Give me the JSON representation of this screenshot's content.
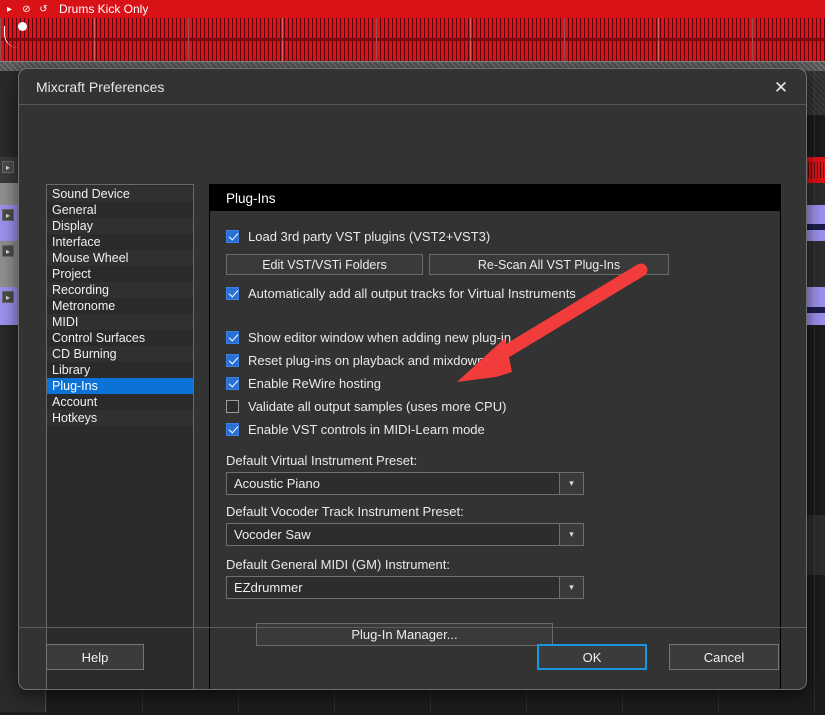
{
  "background": {
    "clip_label": "Drums Kick Only",
    "clip_controls": [
      "▸",
      "⊘",
      "↺"
    ]
  },
  "dialog": {
    "title": "Mixcraft Preferences",
    "close_icon": "✕"
  },
  "sidebar": {
    "items": [
      {
        "label": "Sound Device",
        "selected": false
      },
      {
        "label": "General",
        "selected": false
      },
      {
        "label": "Display",
        "selected": false
      },
      {
        "label": "Interface",
        "selected": false
      },
      {
        "label": "Mouse Wheel",
        "selected": false
      },
      {
        "label": "Project",
        "selected": false
      },
      {
        "label": "Recording",
        "selected": false
      },
      {
        "label": "Metronome",
        "selected": false
      },
      {
        "label": "MIDI",
        "selected": false
      },
      {
        "label": "Control Surfaces",
        "selected": false
      },
      {
        "label": "CD Burning",
        "selected": false
      },
      {
        "label": "Library",
        "selected": false
      },
      {
        "label": "Plug-Ins",
        "selected": true
      },
      {
        "label": "Account",
        "selected": false
      },
      {
        "label": "Hotkeys",
        "selected": false
      }
    ],
    "selected_color": "#0b72d8"
  },
  "panel": {
    "header": "Plug-Ins",
    "checkboxes": [
      {
        "label": "Load 3rd party VST plugins (VST2+VST3)",
        "checked": true
      },
      {
        "label": "Automatically add all output tracks for Virtual Instruments",
        "checked": true
      },
      {
        "label": "Show editor window when adding new plug-in",
        "checked": true
      },
      {
        "label": "Reset plug-ins on playback and mixdown",
        "checked": true
      },
      {
        "label": "Enable ReWire hosting",
        "checked": true
      },
      {
        "label": "Validate all output samples (uses more CPU)",
        "checked": false
      },
      {
        "label": "Enable VST controls in MIDI-Learn mode",
        "checked": true
      }
    ],
    "buttons": {
      "edit_vst_folders": "Edit VST/VSTi Folders",
      "rescan_vst": "Re-Scan All VST Plug-Ins",
      "plugin_manager": "Plug-In Manager..."
    },
    "fields": [
      {
        "label": "Default Virtual Instrument Preset:",
        "value": "Acoustic Piano",
        "arrow": "▾"
      },
      {
        "label": "Default Vocoder Track Instrument Preset:",
        "value": "Vocoder Saw",
        "arrow": "▾"
      },
      {
        "label": "Default General MIDI (GM) Instrument:",
        "value": "EZdrummer",
        "arrow": "▾"
      }
    ]
  },
  "footer": {
    "help": "Help",
    "ok": "OK",
    "cancel": "Cancel",
    "focus_color": "#1b95e0"
  },
  "annotation": {
    "arrow_color": "#f23b3b"
  }
}
